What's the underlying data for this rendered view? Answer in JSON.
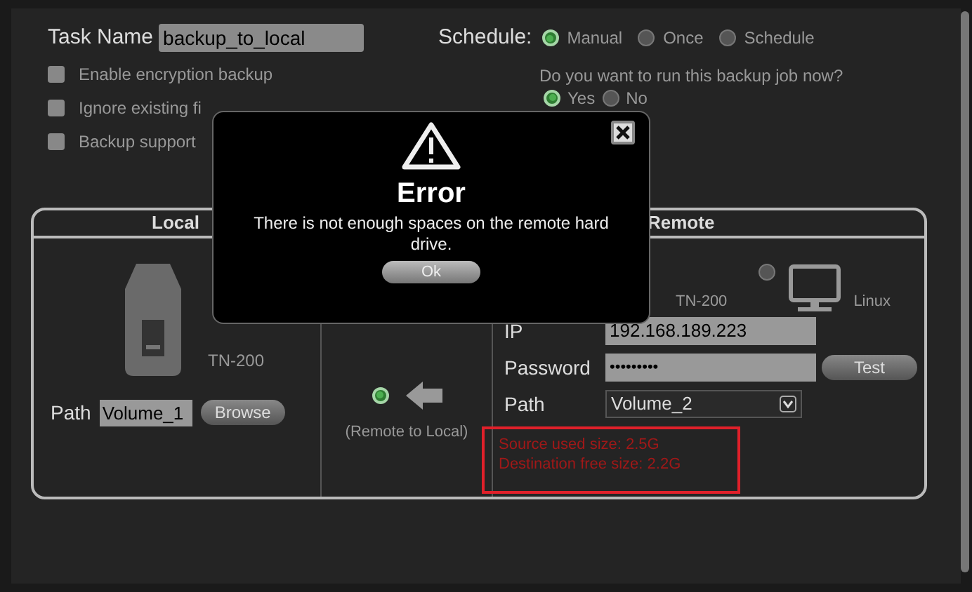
{
  "task_name": {
    "label": "Task Name",
    "value": "backup_to_local"
  },
  "options": [
    {
      "label": "Enable encryption backup",
      "checked": false
    },
    {
      "label": "Ignore existing fi",
      "checked": false
    },
    {
      "label": "Backup support",
      "checked": false
    }
  ],
  "schedule": {
    "label": "Schedule:",
    "options": [
      {
        "label": "Manual",
        "selected": true
      },
      {
        "label": "Once",
        "selected": false
      },
      {
        "label": "Schedule",
        "selected": false
      }
    ]
  },
  "run_now": {
    "question": "Do you want to run this backup job now?",
    "options": [
      {
        "label": "Yes",
        "selected": true
      },
      {
        "label": "No",
        "selected": false
      }
    ]
  },
  "local": {
    "header": "Local",
    "device": "TN-200",
    "path_label": "Path",
    "path_value": "Volume_1",
    "browse": "Browse"
  },
  "direction": {
    "label": "(Remote to Local)",
    "selected": true
  },
  "remote": {
    "header": "Remote",
    "device": "TN-200",
    "linux": {
      "label": "Linux",
      "selected": false
    },
    "ip_label": "IP",
    "ip": "192.168.189.223",
    "password_label": "Password",
    "password": "•••••••••",
    "test": "Test",
    "path_label": "Path",
    "path_value": "Volume_2",
    "info": [
      "Source used size: 2.5G",
      "Destination free size: 2.2G"
    ]
  },
  "dialog": {
    "title": "Error",
    "message": "There is not enough spaces on the remote hard drive.",
    "ok": "Ok"
  }
}
